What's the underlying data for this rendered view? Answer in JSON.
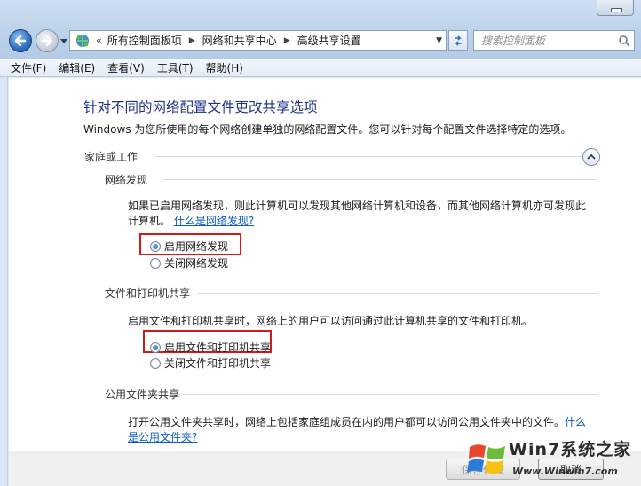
{
  "address_bar": {
    "breadcrumbs": [
      "所有控制面板项",
      "网络和共享中心",
      "高级共享设置"
    ],
    "search_placeholder": "搜索控制面板"
  },
  "menu": [
    "文件(F)",
    "编辑(E)",
    "查看(V)",
    "工具(T)",
    "帮助(H)"
  ],
  "page": {
    "title": "针对不同的网络配置文件更改共享选项",
    "description": "Windows 为您所使用的每个网络创建单独的网络配置文件。您可以针对每个配置文件选择特定的选项。",
    "profile_group": "家庭或工作"
  },
  "sections": {
    "discovery": {
      "title": "网络发现",
      "desc_line1": "如果已启用网络发现，则此计算机可以发现其他网络计算机和设备，而其他网络计算机亦可发现此",
      "desc_line2": "计算机。",
      "link": "什么是网络发现?",
      "option_on": "启用网络发现",
      "option_off": "关闭网络发现",
      "selected": "on"
    },
    "file_printer": {
      "title": "文件和打印机共享",
      "desc": "启用文件和打印机共享时，网络上的用户可以访问通过此计算机共享的文件和打印机。",
      "option_on": "启用文件和打印机共享",
      "option_off": "关闭文件和打印机共享",
      "selected": "on"
    },
    "public_folder": {
      "title": "公用文件夹共享",
      "desc_line1": "打开公用文件夹共享时，网络上包括家庭组成员在内的用户都可以访问公用文件夹中的文件。",
      "link_part1": "什么",
      "link_part2": "是公用文件夹?"
    }
  },
  "buttons": {
    "save": "保存修改",
    "cancel": "取消"
  },
  "watermark": {
    "title": "Win7系统之家",
    "url": "Www.Winwin7.com"
  },
  "colors": {
    "title_blue": "#1e3287",
    "link_blue": "#0b5cc7",
    "highlight_red": "#d21a1a"
  }
}
